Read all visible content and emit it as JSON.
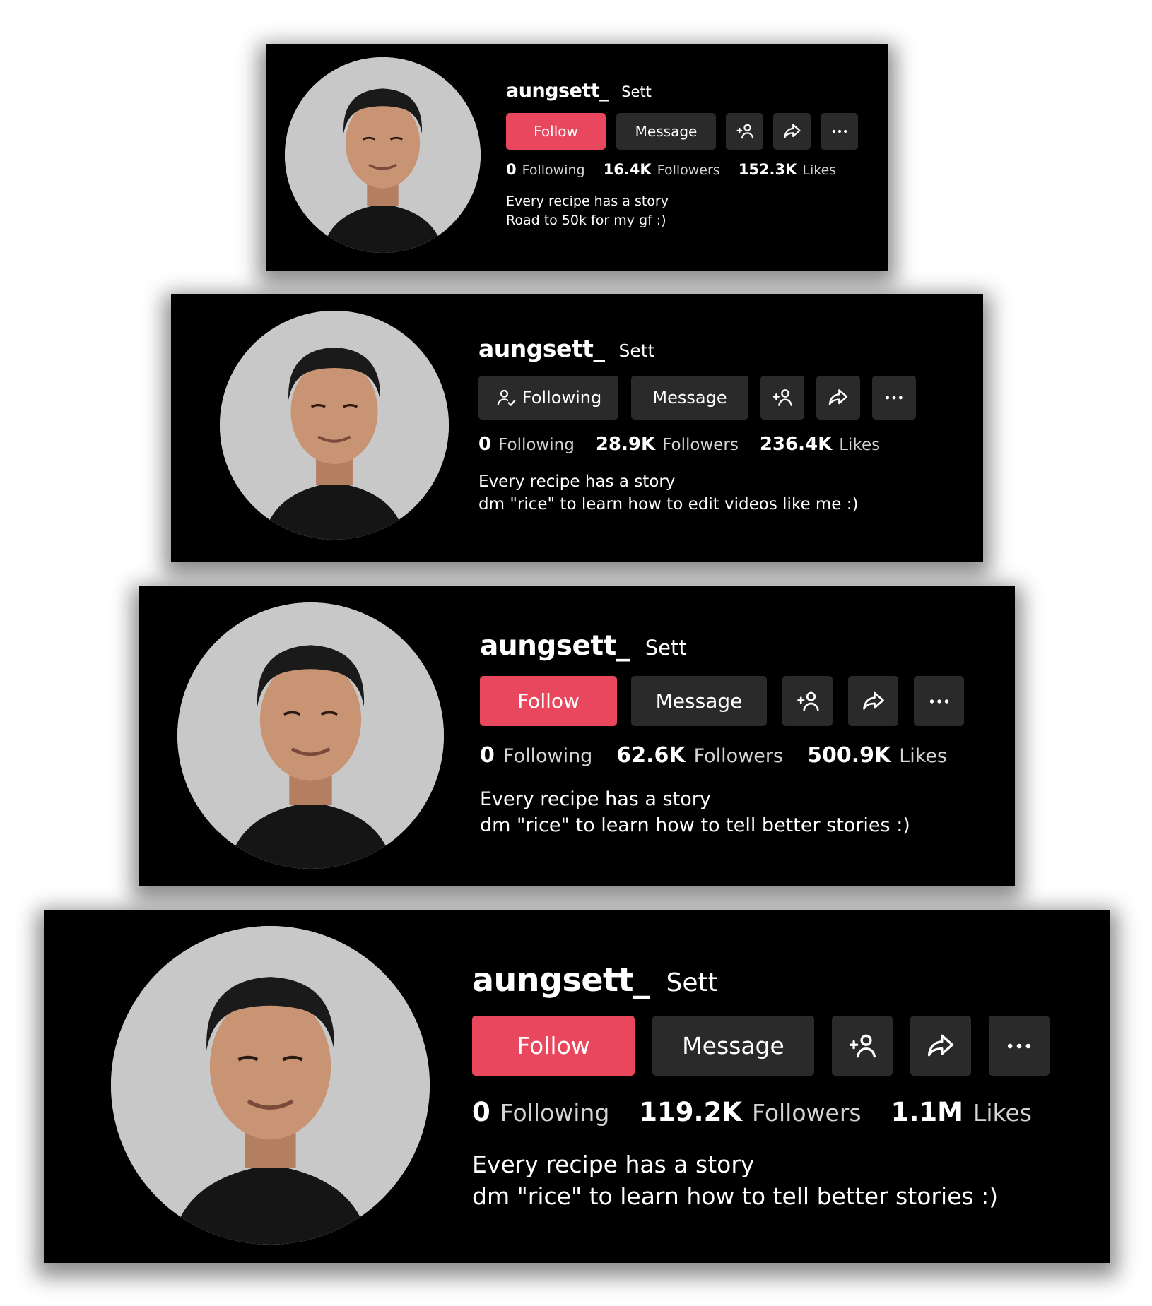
{
  "cards": [
    {
      "username": "aungsett_",
      "nickname": "Sett",
      "primary_button": "Follow",
      "message_button": "Message",
      "stats": [
        {
          "value": "0",
          "label": "Following"
        },
        {
          "value": "16.4K",
          "label": "Followers"
        },
        {
          "value": "152.3K",
          "label": "Likes"
        }
      ],
      "bio": [
        "Every recipe has a story",
        "Road to 50k for my gf :)"
      ]
    },
    {
      "username": "aungsett_",
      "nickname": "Sett",
      "primary_button": "Following",
      "message_button": "Message",
      "stats": [
        {
          "value": "0",
          "label": "Following"
        },
        {
          "value": "28.9K",
          "label": "Followers"
        },
        {
          "value": "236.4K",
          "label": "Likes"
        }
      ],
      "bio": [
        "Every recipe has a story",
        "dm \"rice\" to learn how to edit videos like me :)"
      ]
    },
    {
      "username": "aungsett_",
      "nickname": "Sett",
      "primary_button": "Follow",
      "message_button": "Message",
      "stats": [
        {
          "value": "0",
          "label": "Following"
        },
        {
          "value": "62.6K",
          "label": "Followers"
        },
        {
          "value": "500.9K",
          "label": "Likes"
        }
      ],
      "bio": [
        "Every recipe has a story",
        "dm \"rice\" to learn how to tell better stories :)"
      ]
    },
    {
      "username": "aungsett_",
      "nickname": "Sett",
      "primary_button": "Follow",
      "message_button": "Message",
      "stats": [
        {
          "value": "0",
          "label": "Following"
        },
        {
          "value": "119.2K",
          "label": "Followers"
        },
        {
          "value": "1.1M",
          "label": "Likes"
        }
      ],
      "bio": [
        "Every recipe has a story",
        "dm \"rice\" to learn how to tell better stories :)"
      ]
    }
  ],
  "colors": {
    "card_background": "#000000",
    "follow_button": "#e8475d",
    "dark_button": "#2a2a2a"
  },
  "icons": [
    "user-check-icon",
    "add-friend-icon",
    "share-icon",
    "more-icon"
  ]
}
